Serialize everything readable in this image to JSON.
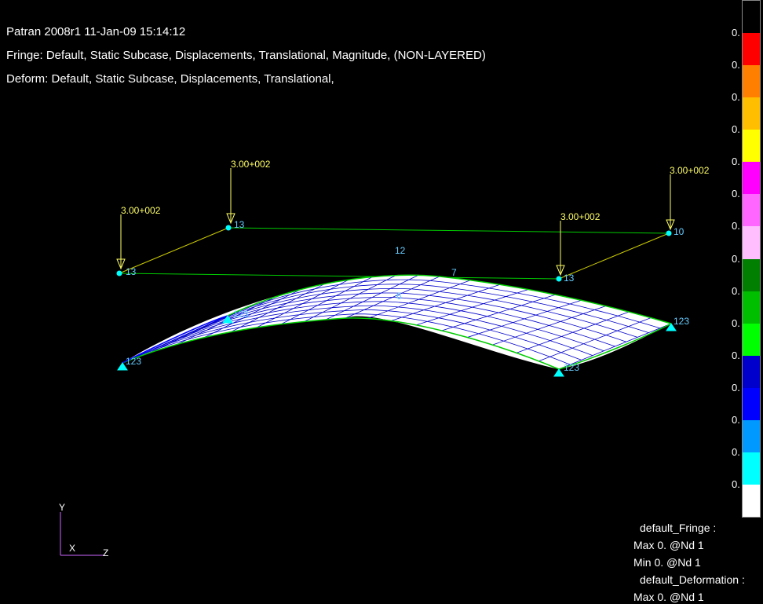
{
  "header": {
    "line1": "Patran 2008r1 11-Jan-09 15:14:12",
    "line2": "Fringe: Default, Static Subcase, Displacements, Translational, Magnitude, (NON-LAYERED)",
    "line3": "Deform: Default, Static Subcase, Displacements, Translational,"
  },
  "load_labels": [
    "3.00+002",
    "3.00+002",
    "3.00+002",
    "3.00+002"
  ],
  "node_labels": {
    "n13a": "13",
    "n13b": "13",
    "n13c": "13",
    "n10": "10",
    "mid12": "12",
    "mid7": "7",
    "mid6": "6",
    "s123a": "123",
    "s123b": "123",
    "s123c": "123",
    "s123d": "123"
  },
  "legend": {
    "colors": [
      "#000000",
      "#ff0000",
      "#ff7f00",
      "#ffbf00",
      "#ffff00",
      "#ff00ff",
      "#ff66ff",
      "#ffbfff",
      "#007f00",
      "#00bf00",
      "#00ff00",
      "#0000cc",
      "#0000ff",
      "#0099ff",
      "#00ffff",
      "#ffffff"
    ],
    "values": [
      "0.",
      "0.",
      "0.",
      "0.",
      "0.",
      "0.",
      "0.",
      "0.",
      "0.",
      "0.",
      "0.",
      "0.",
      "0.",
      "0.",
      "0.",
      "0."
    ]
  },
  "stats": {
    "fringe_title": "default_Fringe :",
    "fringe_max": "Max  0. @Nd 1",
    "fringe_min": "Min  0. @Nd 1",
    "deform_title": "default_Deformation :",
    "deform_max": "Max  0. @Nd 1"
  },
  "triad": {
    "y": "Y",
    "x": "X",
    "z": "Z"
  }
}
